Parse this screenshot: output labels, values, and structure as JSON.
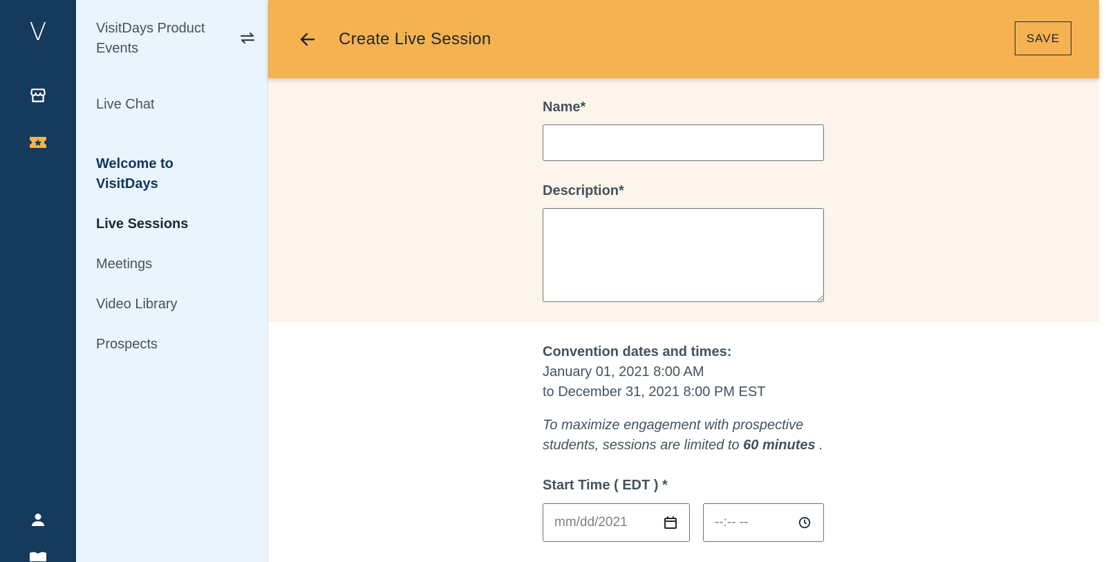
{
  "rail": {
    "logo": "V",
    "icons": [
      "store-icon",
      "ticket-star-icon",
      "person-icon",
      "book-icon"
    ],
    "active_color": "#f4b250"
  },
  "sidebar": {
    "org_name": "VisitDays Product Events",
    "items": [
      {
        "label": "Live Chat"
      },
      {
        "label": "Welcome to VisitDays"
      },
      {
        "label": "Live Sessions"
      },
      {
        "label": "Meetings"
      },
      {
        "label": "Video Library"
      },
      {
        "label": "Prospects"
      }
    ]
  },
  "header": {
    "title": "Create Live Session",
    "save_label": "SAVE",
    "background": "#f4b250"
  },
  "form": {
    "name_label": "Name*",
    "name_value": "",
    "description_label": "Description*",
    "description_value": ""
  },
  "convention": {
    "title": "Convention dates and times:",
    "start": "January 01, 2021 8:00 AM",
    "end": "to December 31, 2021 8:00 PM EST"
  },
  "note": {
    "prefix": "To maximize engagement with prospective students, sessions are limited to ",
    "emphasis": "60 minutes",
    "suffix": " ."
  },
  "start_time": {
    "label": "Start Time ( EDT ) *",
    "date_placeholder": "mm/dd/2021",
    "time_placeholder": "--:-- --"
  }
}
